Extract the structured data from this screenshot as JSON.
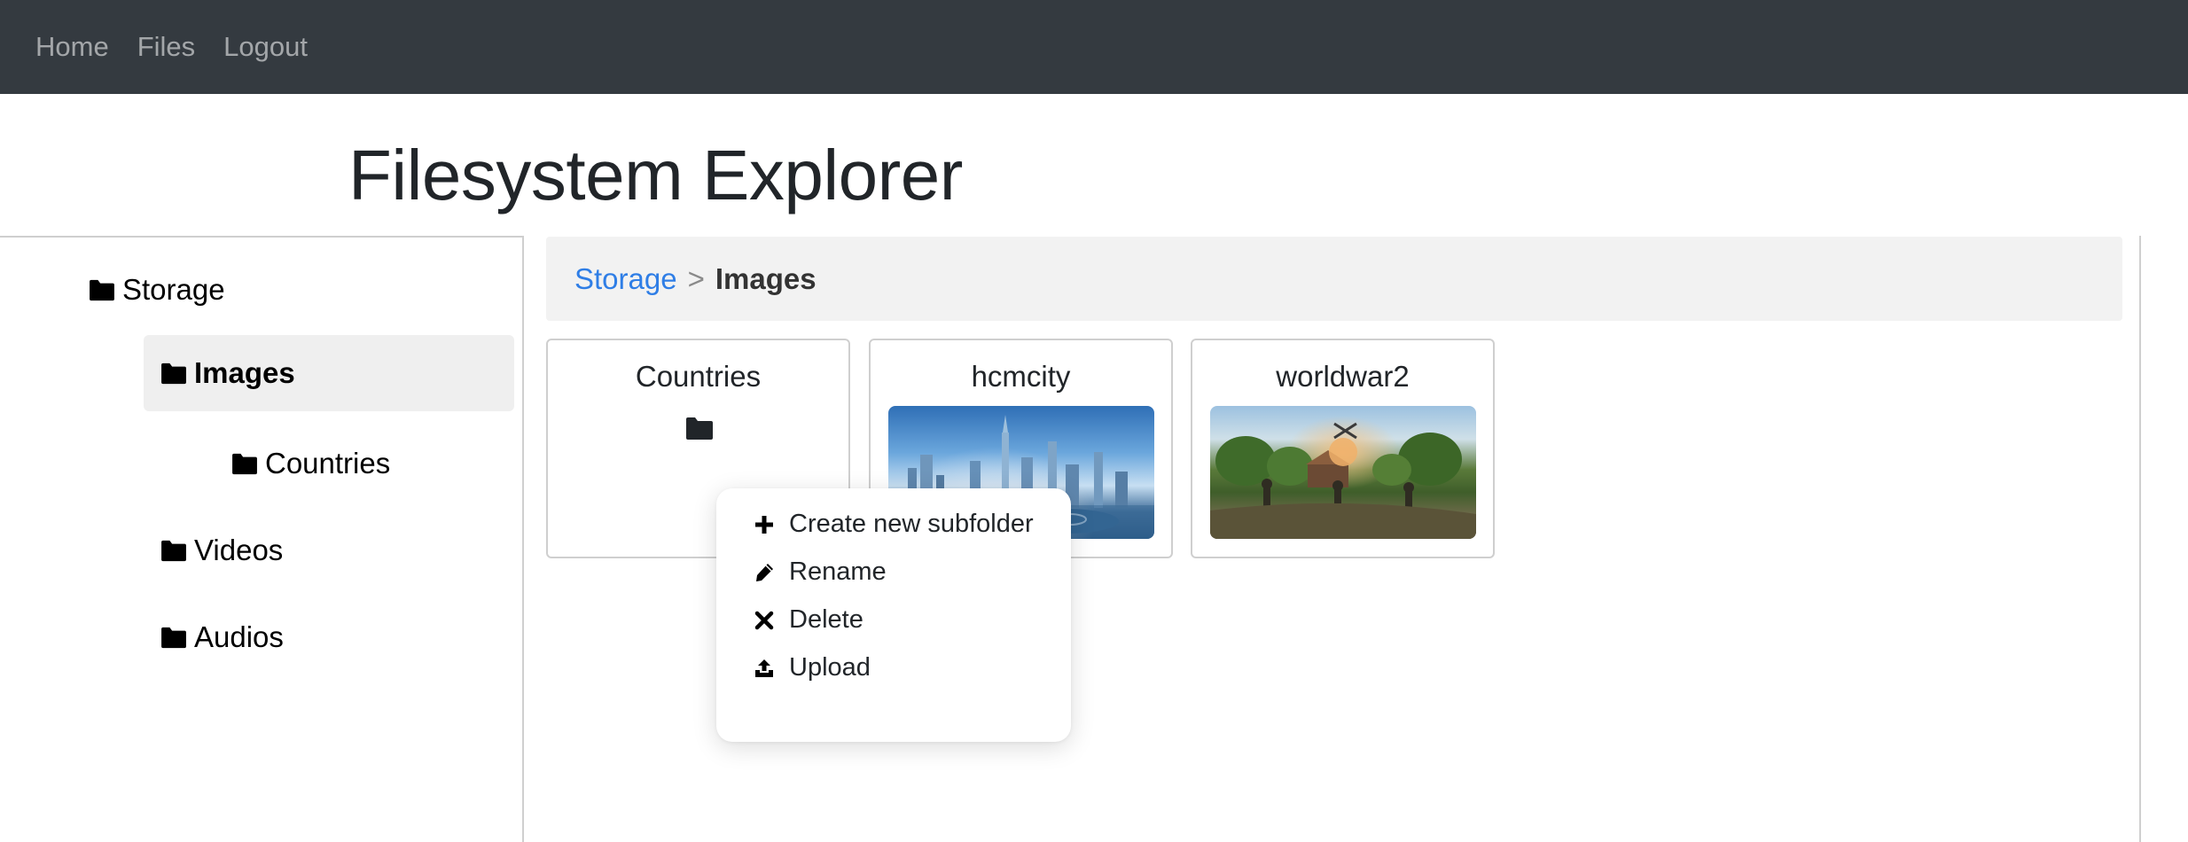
{
  "navbar": {
    "links": [
      "Home",
      "Files",
      "Logout"
    ]
  },
  "page": {
    "title": "Filesystem Explorer"
  },
  "sidebar": {
    "tree": [
      {
        "label": "Storage",
        "icon": "folder-icon"
      },
      {
        "label": "Images",
        "icon": "folder-icon",
        "active": true
      },
      {
        "label": "Countries",
        "icon": "folder-icon"
      },
      {
        "label": "Videos",
        "icon": "folder-icon"
      },
      {
        "label": "Audios",
        "icon": "folder-icon"
      }
    ]
  },
  "breadcrumb": {
    "root": "Storage",
    "separator": ">",
    "current": "Images"
  },
  "items": [
    {
      "name": "Countries",
      "type": "folder"
    },
    {
      "name": "hcmcity",
      "type": "image"
    },
    {
      "name": "worldwar2",
      "type": "image"
    }
  ],
  "context_menu": {
    "items": [
      {
        "label": "Create new subfolder",
        "icon": "plus-icon"
      },
      {
        "label": "Rename",
        "icon": "pencil-icon"
      },
      {
        "label": "Delete",
        "icon": "x-icon"
      },
      {
        "label": "Upload",
        "icon": "upload-icon"
      }
    ]
  },
  "colors": {
    "navbar_bg": "#343a40",
    "link": "#2f7ee6",
    "active_bg": "#efefef"
  }
}
